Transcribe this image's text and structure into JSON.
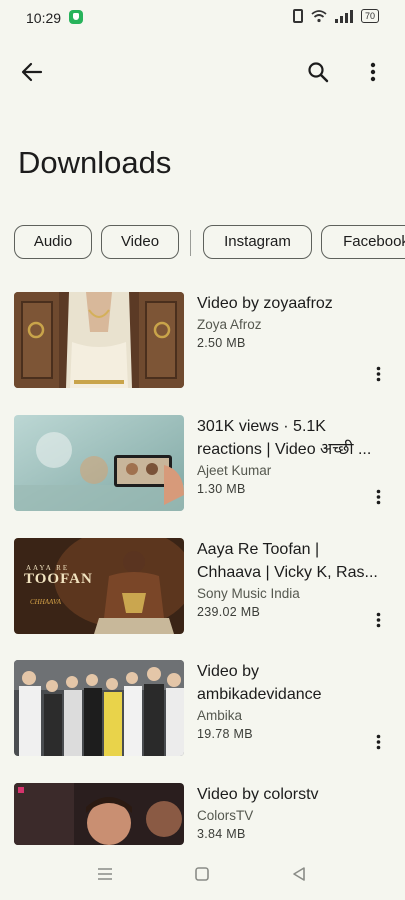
{
  "status": {
    "time": "10:29",
    "battery": "70"
  },
  "header": {
    "title": "Downloads"
  },
  "filters": [
    "Audio",
    "Video",
    "Instagram",
    "Facebook"
  ],
  "videos": [
    {
      "title": "Video by zoyaafroz",
      "author": "Zoya Afroz",
      "size": "2.50 MB"
    },
    {
      "title": "301K views · 5.1K reactions | Video अच्छी ...",
      "author": "Ajeet Kumar",
      "size": "1.30 MB"
    },
    {
      "title": "Aaya Re Toofan | Chhaava | Vicky K, Ras...",
      "author": "Sony Music India",
      "size": "239.02 MB"
    },
    {
      "title": "Video by ambikadevidance",
      "author": "Ambika",
      "size": "19.78 MB"
    },
    {
      "title": "Video by colorstv",
      "author": "ColorsTV",
      "size": "3.84 MB"
    }
  ],
  "thumb_text": {
    "poster_line1": "AAYA RE",
    "poster_line2": "TOOFAN",
    "poster_line3": "CHHAAVA"
  },
  "icons": {
    "back": "arrow-left-icon",
    "search": "search-icon",
    "more": "more-vert-icon",
    "nav_recents": "menu-icon",
    "nav_home": "square-icon",
    "nav_back": "triangle-back-icon"
  },
  "colors": {
    "background": "#f5f6ef",
    "chip_border": "#5e615c",
    "text": "#1c1c1c"
  }
}
